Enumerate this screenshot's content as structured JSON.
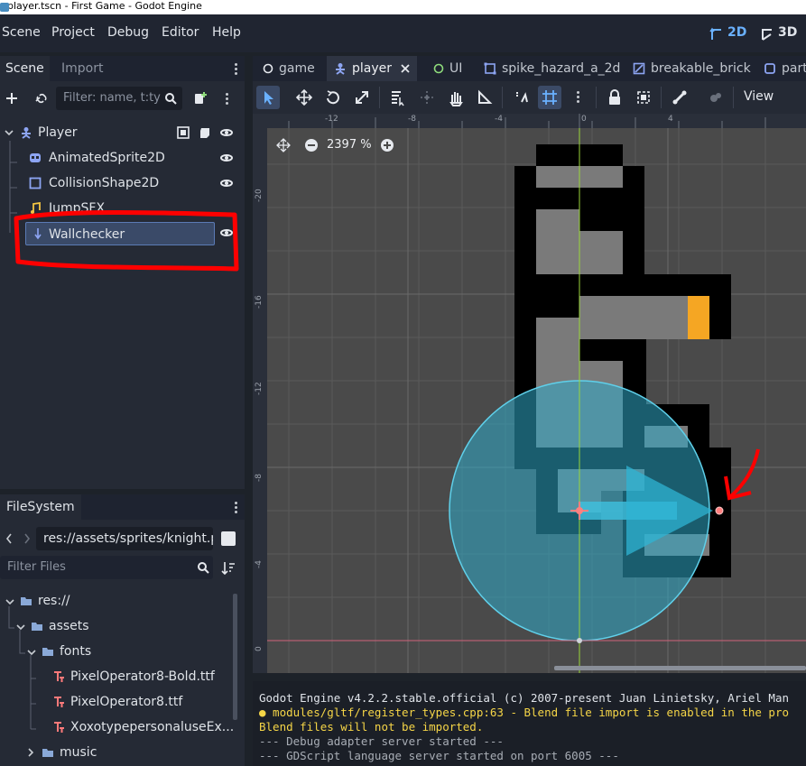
{
  "window": {
    "title": "player.tscn - First Game - Godot Engine"
  },
  "menu": {
    "items": [
      "Scene",
      "Project",
      "Debug",
      "Editor",
      "Help"
    ],
    "mode_2d": "2D",
    "mode_3d": "3D"
  },
  "scene_dock": {
    "tabs": [
      "Scene",
      "Import"
    ],
    "filter_placeholder": "Filter: name, t:ty",
    "nodes": [
      {
        "name": "Player",
        "icon": "character-body-icon"
      },
      {
        "name": "AnimatedSprite2D",
        "icon": "animated-sprite-icon"
      },
      {
        "name": "CollisionShape2D",
        "icon": "collision-shape-icon"
      },
      {
        "name": "JumpSFX",
        "icon": "audio-icon"
      },
      {
        "name": "Wallchecker",
        "icon": "raycast-icon"
      }
    ]
  },
  "filesystem": {
    "title": "FileSystem",
    "path": "res://assets/sprites/knight.p",
    "filter_placeholder": "Filter Files",
    "items": [
      {
        "name": "res://",
        "type": "folder"
      },
      {
        "name": "assets",
        "type": "folder"
      },
      {
        "name": "fonts",
        "type": "folder"
      },
      {
        "name": "PixelOperator8-Bold.ttf",
        "type": "font"
      },
      {
        "name": "PixelOperator8.ttf",
        "type": "font"
      },
      {
        "name": "XoxotypepersonaluseEx...",
        "type": "font"
      },
      {
        "name": "music",
        "type": "folder"
      }
    ]
  },
  "editor_tabs": [
    {
      "label": "game",
      "icon": "node-circle-icon"
    },
    {
      "label": "player",
      "icon": "character-body-icon"
    },
    {
      "label": "UI",
      "icon": "control-circle-icon"
    },
    {
      "label": "spike_hazard_a_2d",
      "icon": "area-icon"
    },
    {
      "label": "breakable_brick",
      "icon": "static-body-icon"
    },
    {
      "label": "part",
      "icon": "scene-icon"
    }
  ],
  "canvas_toolbar": {
    "view_label": "View"
  },
  "viewport": {
    "zoom": "2397 %",
    "ruler_top": [
      "-12",
      "-8",
      "-4",
      "0",
      "4"
    ],
    "ruler_left": [
      "-20",
      "-16",
      "-12",
      "-8",
      "-4",
      "0"
    ]
  },
  "output": {
    "lines": [
      {
        "text": "Godot Engine v4.2.2.stable.official (c) 2007-present Juan Linietsky, Ariel Man",
        "color": "#e0e4ea"
      },
      {
        "text": "● modules/gltf/register_types.cpp:63 - Blend file import is enabled in the pro",
        "color": "#f5d547"
      },
      {
        "text": "Blend files will not be imported.",
        "color": "#f5d547"
      },
      {
        "text": "--- Debug adapter server started ---",
        "color": "#a8adb5"
      },
      {
        "text": "--- GDScript language server started on port 6005 ---",
        "color": "#a8adb5"
      }
    ]
  },
  "colors": {
    "accent": "#6ab1ff",
    "selection": "#3a4a68",
    "annotation": "#ff0000",
    "collision": "#30a9c8"
  }
}
